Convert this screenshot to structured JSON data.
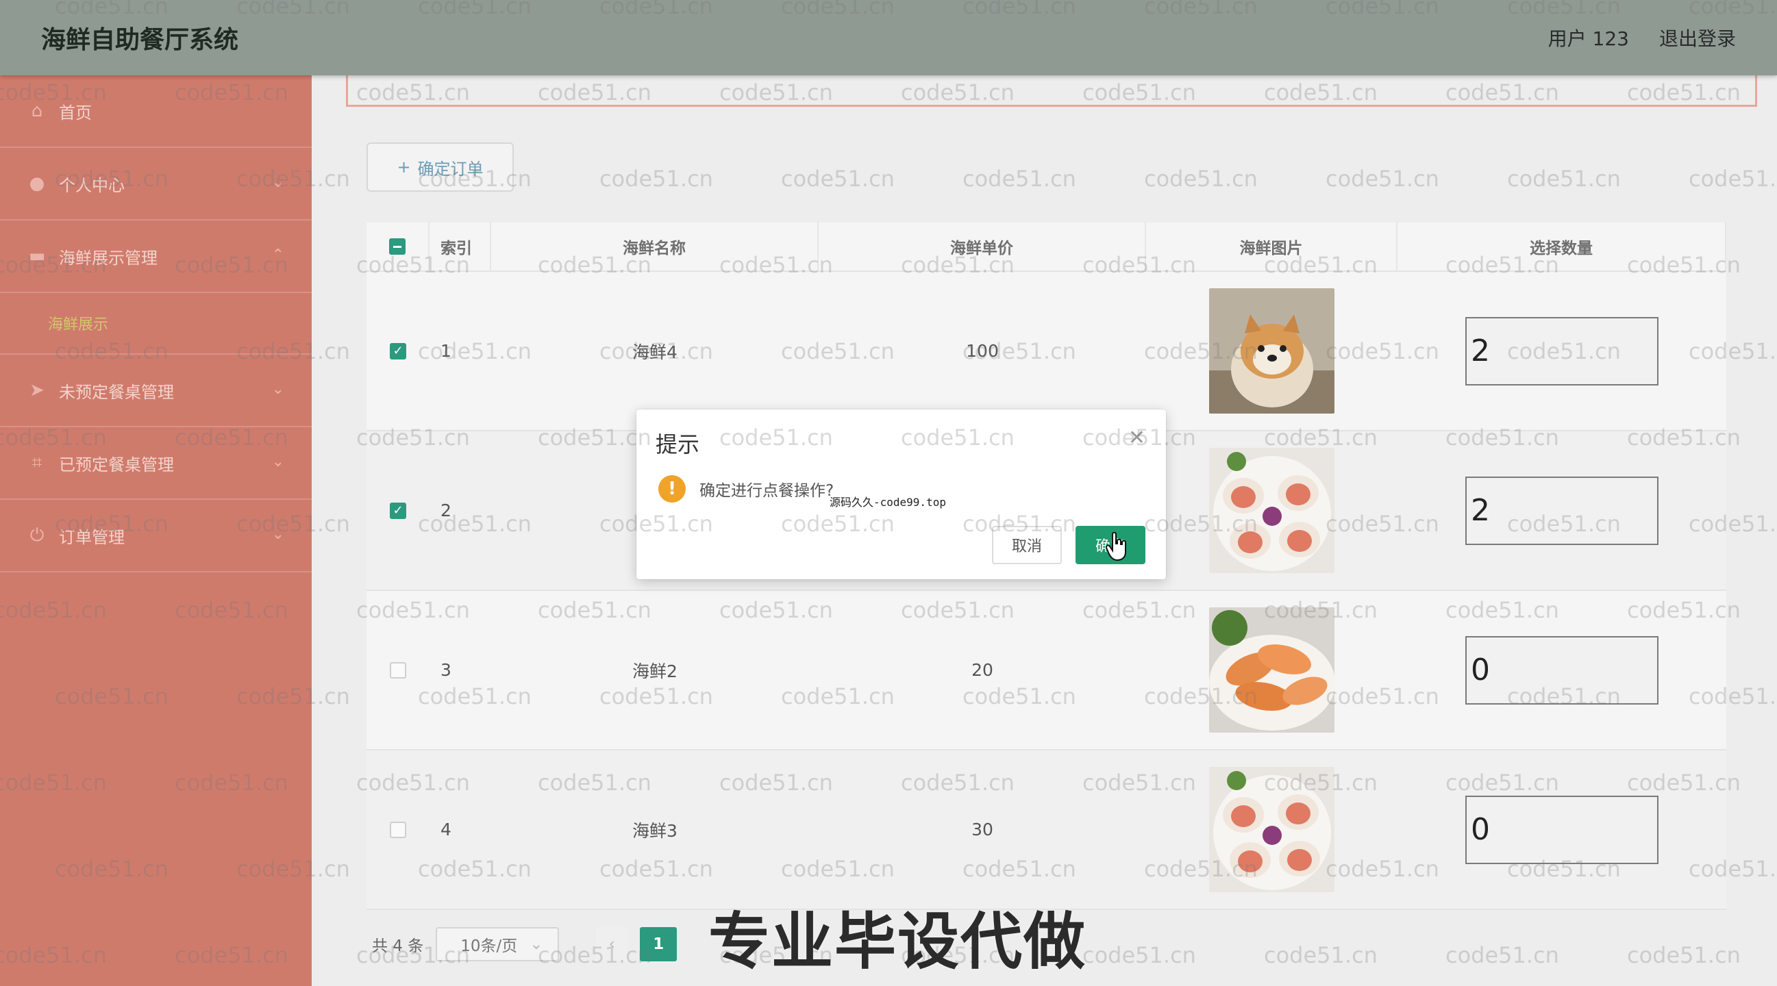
{
  "header": {
    "brand": "海鲜自助餐厅系统",
    "user": "用户 123",
    "logout": "退出登录"
  },
  "sidebar": {
    "items": [
      {
        "label": "首页",
        "icon": "home-icon"
      },
      {
        "label": "个人中心",
        "icon": "user-icon"
      },
      {
        "label": "海鲜展示管理",
        "icon": "monitor-icon"
      },
      {
        "label": "未预定餐桌管理",
        "icon": "send-icon"
      },
      {
        "label": "已预定餐桌管理",
        "icon": "crop-icon"
      },
      {
        "label": "订单管理",
        "icon": "power-icon"
      }
    ],
    "submenu": "海鲜展示"
  },
  "toolbar": {
    "confirm_order": "确定订单"
  },
  "table": {
    "headers": [
      "索引",
      "海鲜名称",
      "海鲜单价",
      "海鲜图片",
      "选择数量"
    ],
    "rows": [
      {
        "index": "1",
        "name": "海鲜4",
        "price": "100",
        "image": "dog-photo",
        "qty": "2",
        "checked": true
      },
      {
        "index": "2",
        "name": "",
        "price": "",
        "image": "scallop-photo",
        "qty": "2",
        "checked": true
      },
      {
        "index": "3",
        "name": "海鲜2",
        "price": "20",
        "image": "shrimp-photo",
        "qty": "0",
        "checked": false
      },
      {
        "index": "4",
        "name": "海鲜3",
        "price": "30",
        "image": "scallop-photo",
        "qty": "0",
        "checked": false
      }
    ]
  },
  "pager": {
    "total": "共 4 条",
    "page_size": "10条/页",
    "current": "1"
  },
  "dialog": {
    "title": "提示",
    "message": "确定进行点餐操作?",
    "note": "源码久久-code99.top",
    "cancel": "取消",
    "ok": "确定"
  },
  "watermark": "code51.cn",
  "caption": "专业毕设代做",
  "colors": {
    "header": "#8f9a92",
    "sidebar": "#cf7b6c",
    "accent": "#2b9a7f",
    "warning": "#f0a329"
  }
}
